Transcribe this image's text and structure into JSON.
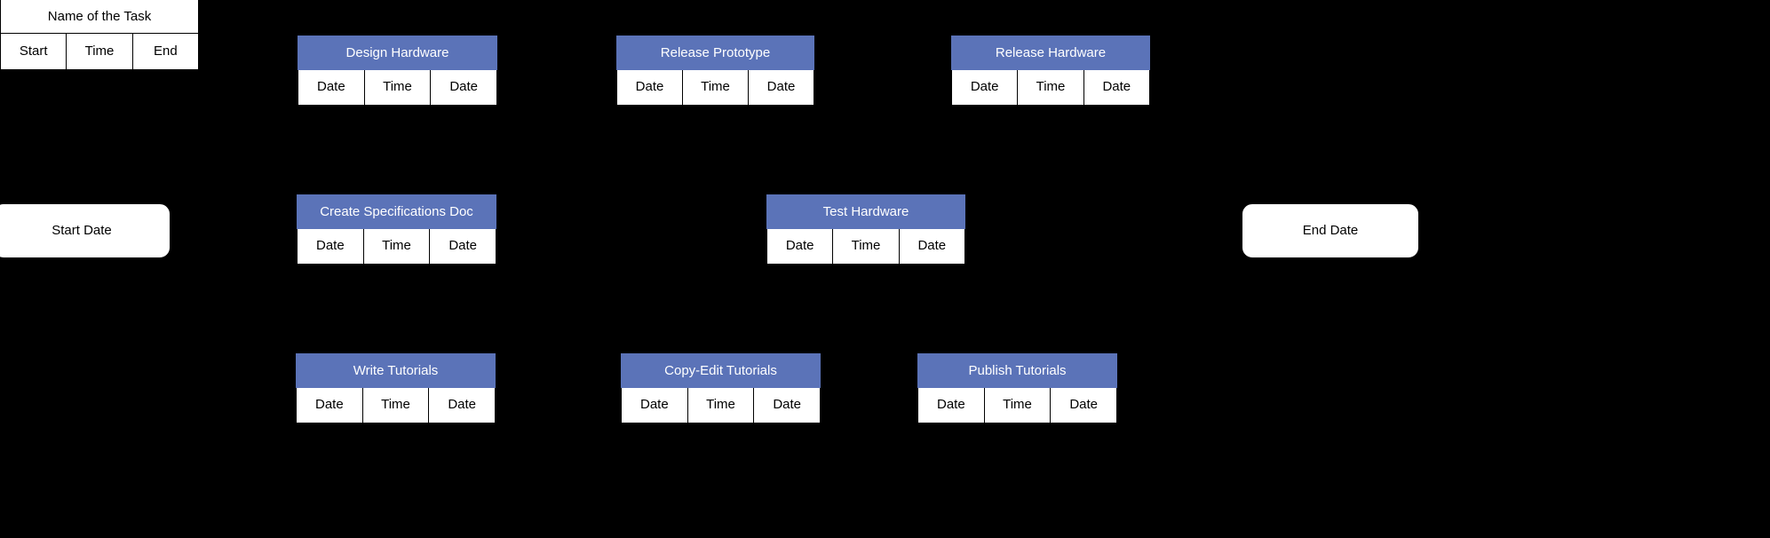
{
  "diagram": {
    "background_color": "#000000",
    "node_header_color": "#5b73b8",
    "node_body_color": "#ffffff",
    "node_border_color": "#000000",
    "header_text_color": "#ffffff"
  },
  "legend": {
    "title": "Name of the Task",
    "cells": [
      "Start",
      "Time",
      "End"
    ]
  },
  "terminals": [
    {
      "label": "Start Date"
    },
    {
      "label": "End Date"
    }
  ],
  "tasks": [
    {
      "title": "Design Hardware",
      "cells": [
        "Date",
        "Time",
        "Date"
      ]
    },
    {
      "title": "Release Prototype",
      "cells": [
        "Date",
        "Time",
        "Date"
      ]
    },
    {
      "title": "Release Hardware",
      "cells": [
        "Date",
        "Time",
        "Date"
      ]
    },
    {
      "title": "Create Specifications Doc",
      "cells": [
        "Date",
        "Time",
        "Date"
      ]
    },
    {
      "title": "Test Hardware",
      "cells": [
        "Date",
        "Time",
        "Date"
      ]
    },
    {
      "title": "Write Tutorials",
      "cells": [
        "Date",
        "Time",
        "Date"
      ]
    },
    {
      "title": "Copy-Edit Tutorials",
      "cells": [
        "Date",
        "Time",
        "Date"
      ]
    },
    {
      "title": "Publish Tutorials",
      "cells": [
        "Date",
        "Time",
        "Date"
      ]
    }
  ]
}
